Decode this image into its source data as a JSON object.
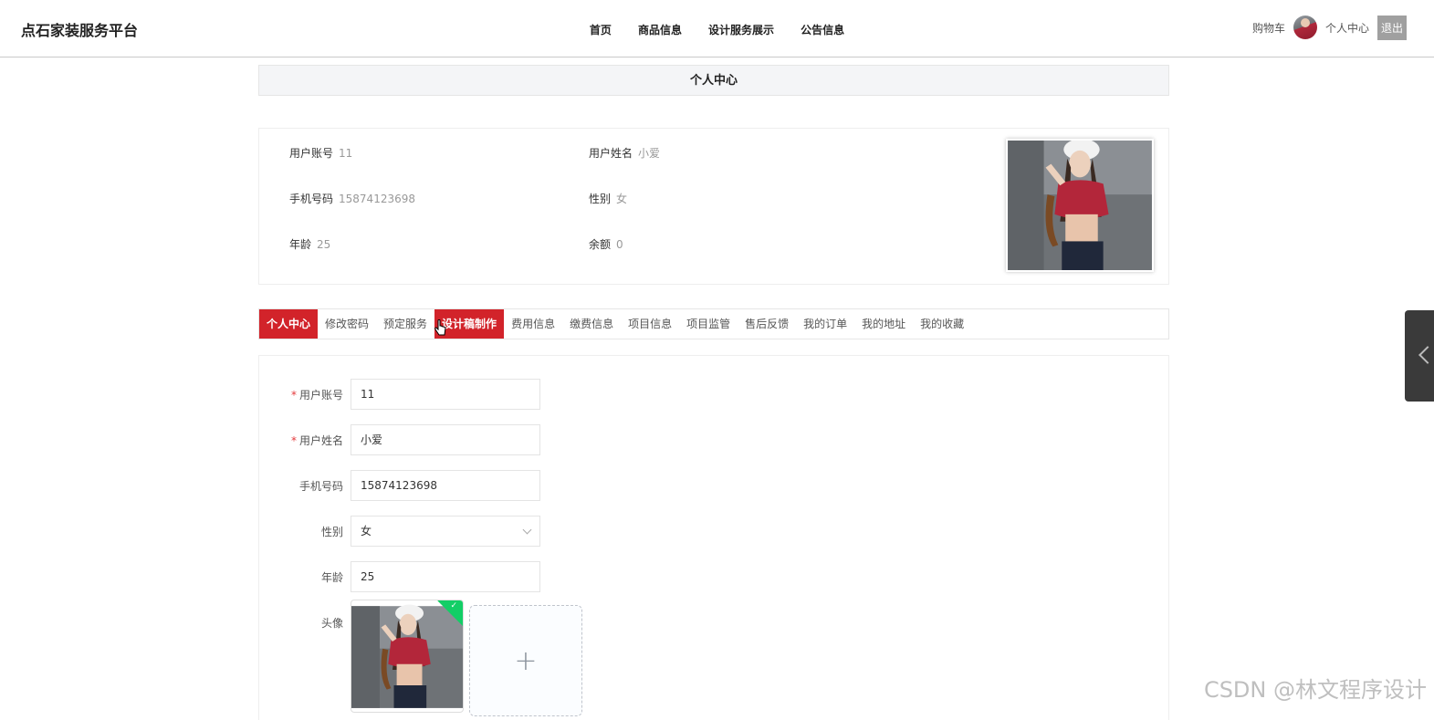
{
  "header": {
    "logo": "点石家装服务平台",
    "nav": [
      "首页",
      "商品信息",
      "设计服务展示",
      "公告信息"
    ],
    "cart": "购物车",
    "user_center": "个人中心",
    "logout": "退出"
  },
  "page_title": "个人中心",
  "profile": {
    "account_label": "用户账号",
    "account": "11",
    "name_label": "用户姓名",
    "name": "小爱",
    "phone_label": "手机号码",
    "phone": "15874123698",
    "gender_label": "性别",
    "gender": "女",
    "age_label": "年龄",
    "age": "25",
    "balance_label": "余额",
    "balance": "0"
  },
  "tabs": [
    "个人中心",
    "修改密码",
    "预定服务",
    "设计稿制作",
    "费用信息",
    "缴费信息",
    "项目信息",
    "项目监管",
    "售后反馈",
    "我的订单",
    "我的地址",
    "我的收藏"
  ],
  "form": {
    "required_mark": "*",
    "account_label": "用户账号",
    "account_value": "11",
    "name_label": "用户姓名",
    "name_value": "小爱",
    "phone_label": "手机号码",
    "phone_value": "15874123698",
    "gender_label": "性别",
    "gender_value": "女",
    "age_label": "年龄",
    "age_value": "25",
    "avatar_label": "头像",
    "upload_plus": "+"
  },
  "watermark": "CSDN @林文程序设计",
  "colors": {
    "accent": "#d2232a",
    "success": "#13ce66"
  }
}
